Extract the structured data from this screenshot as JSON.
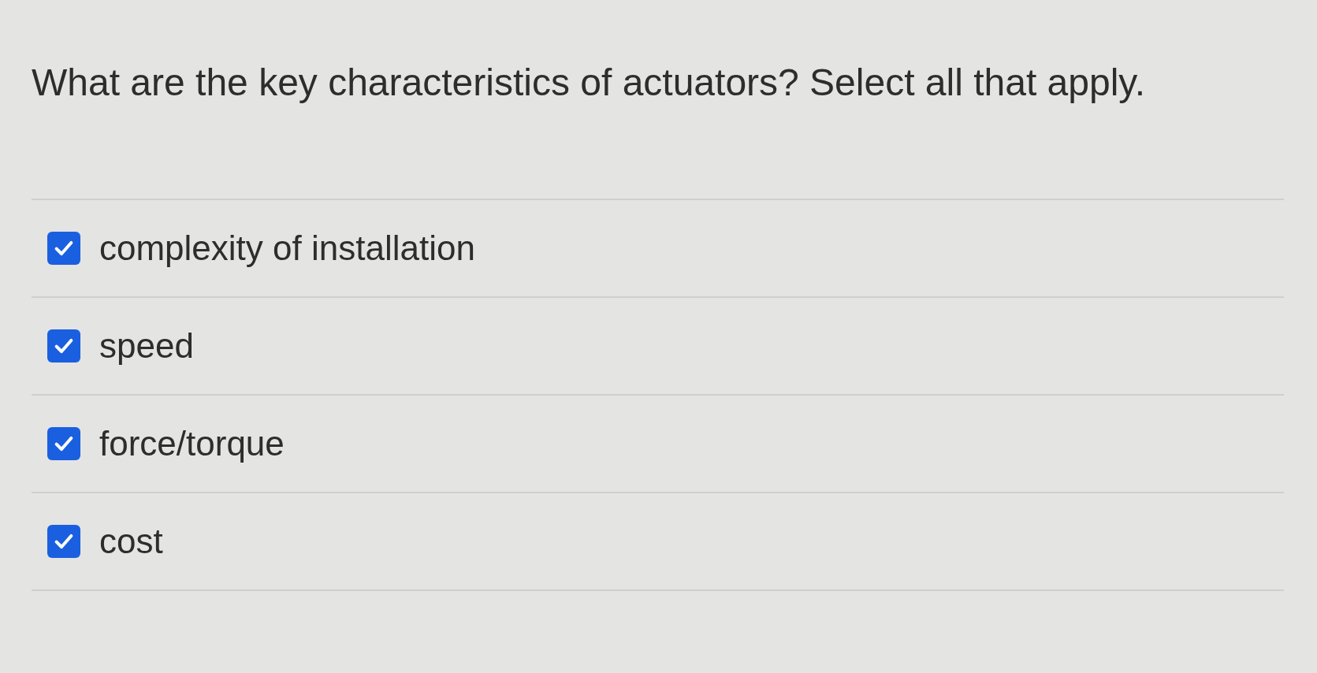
{
  "question": "What are the key characteristics of actuators? Select all that apply.",
  "options": [
    {
      "label": "complexity of installation",
      "checked": true
    },
    {
      "label": "speed",
      "checked": true
    },
    {
      "label": "force/torque",
      "checked": true
    },
    {
      "label": "cost",
      "checked": true
    }
  ]
}
